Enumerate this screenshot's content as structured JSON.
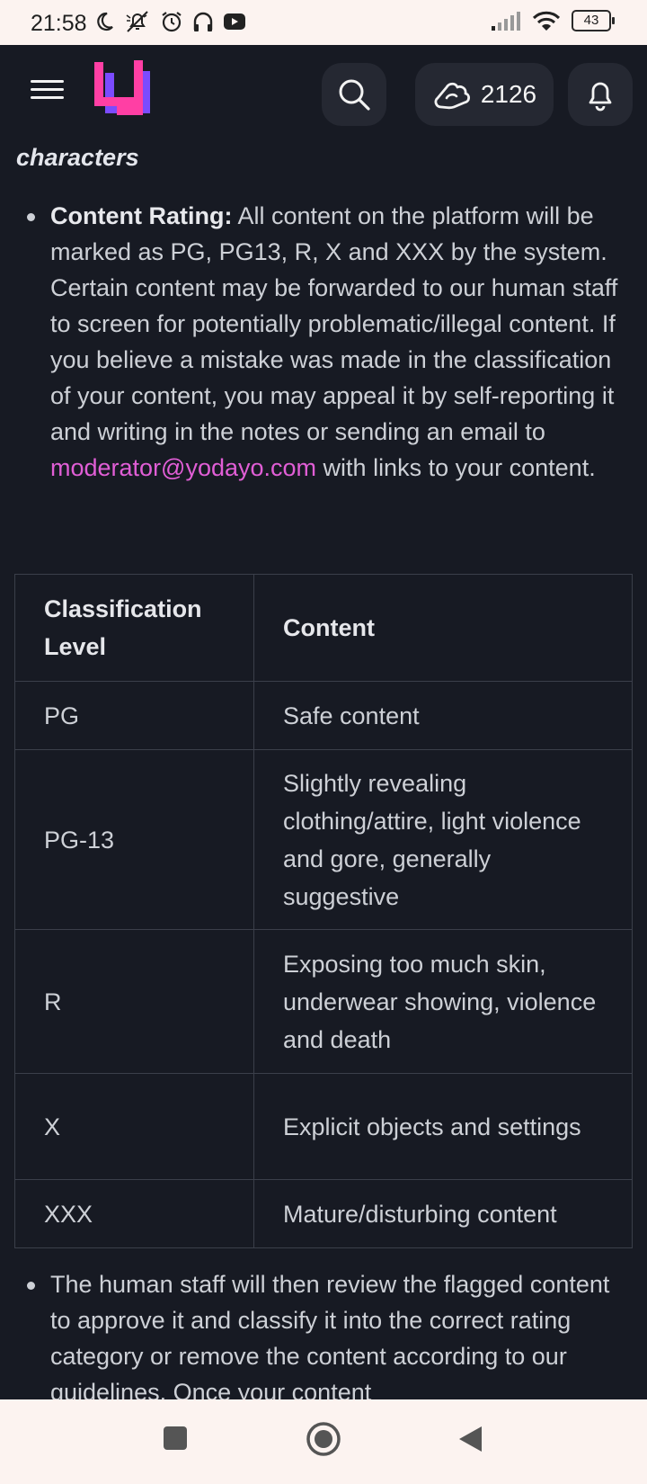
{
  "status_bar": {
    "time": "21:58",
    "battery": "43",
    "left_icons": [
      "moon-icon",
      "mute-icon",
      "alarm-icon",
      "headphones-icon",
      "youtube-icon"
    ],
    "right_icons": [
      "signal-icon",
      "wifi-icon",
      "battery-icon"
    ]
  },
  "app_bar": {
    "credits": "2126",
    "icons": [
      "menu-icon",
      "yodayo-logo",
      "search-icon",
      "credits-icon",
      "bell-icon"
    ],
    "logo_colors": [
      "#ff3fa4",
      "#7b4bff"
    ]
  },
  "content": {
    "partial_heading": "characters",
    "bullet1": {
      "label": "Content Rating:",
      "text_before_link": " All content on the platform will be marked as PG, PG13, R, X and XXX by the system. Certain content may be forwarded to our human staff to screen for potentially problematic/illegal content. If you believe a mistake was made in the classification of your content, you may appeal it by self-reporting it and writing in the notes or sending an email to ",
      "link": "moderator@yodayo.com",
      "text_after_link": " with links to your content."
    },
    "table": {
      "headers": [
        "Classification Level",
        "Content"
      ],
      "rows": [
        [
          "PG",
          "Safe content"
        ],
        [
          "PG-13",
          "Slightly revealing clothing/attire, light violence and gore, generally suggestive"
        ],
        [
          "R",
          "Exposing too much skin, underwear showing, violence and death"
        ],
        [
          "X",
          "Explicit objects and settings"
        ],
        [
          "XXX",
          "Mature/disturbing content"
        ]
      ]
    },
    "bullet2": "The human staff will then review the flagged content to approve it and classify it into the correct rating category or remove the content according to our guidelines. Once your content"
  },
  "nav_bar": {
    "icons": [
      "recents-icon",
      "home-icon",
      "back-icon"
    ]
  },
  "colors": {
    "background": "#171a23",
    "link": "#e15ed6",
    "status_bar_bg": "#fcf3f0"
  }
}
